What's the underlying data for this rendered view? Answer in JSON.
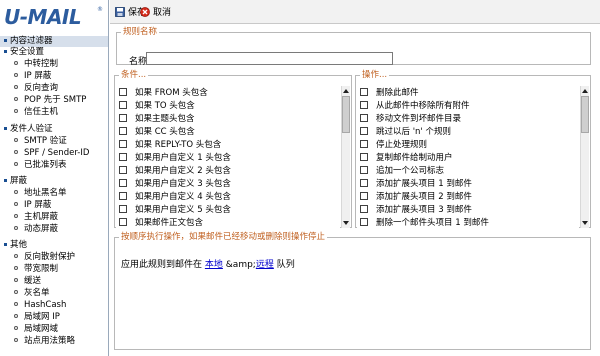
{
  "logo": {
    "text": "U-MAIL",
    "mark": "®"
  },
  "sidebar": {
    "items": [
      {
        "type": "head",
        "label": "内容过滤器",
        "selected": true
      },
      {
        "type": "head",
        "label": "安全设置"
      },
      {
        "type": "sub",
        "label": "中转控制"
      },
      {
        "type": "sub",
        "label": "IP 屏蔽"
      },
      {
        "type": "sub",
        "label": "反向查询"
      },
      {
        "type": "sub",
        "label": "POP 先于 SMTP"
      },
      {
        "type": "sub",
        "label": "信任主机"
      },
      {
        "type": "head",
        "label": "发件人验证"
      },
      {
        "type": "sub",
        "label": "SMTP 验证"
      },
      {
        "type": "sub",
        "label": "SPF / Sender-ID"
      },
      {
        "type": "sub",
        "label": "已批准列表"
      },
      {
        "type": "head",
        "label": "屏蔽"
      },
      {
        "type": "sub",
        "label": "地址黑名单"
      },
      {
        "type": "sub",
        "label": "IP 屏蔽"
      },
      {
        "type": "sub",
        "label": "主机屏蔽"
      },
      {
        "type": "sub",
        "label": "动态屏蔽"
      },
      {
        "type": "head",
        "label": "其他"
      },
      {
        "type": "sub",
        "label": "反向散射保护"
      },
      {
        "type": "sub",
        "label": "带宽限制"
      },
      {
        "type": "sub",
        "label": "缓送"
      },
      {
        "type": "sub",
        "label": "灰名单"
      },
      {
        "type": "sub",
        "label": "HashCash"
      },
      {
        "type": "sub",
        "label": "局域网 IP"
      },
      {
        "type": "sub",
        "label": "局域网域"
      },
      {
        "type": "sub",
        "label": "站点用法策略"
      }
    ]
  },
  "toolbar": {
    "save_label": "保存",
    "cancel_label": "取消"
  },
  "rule_name": {
    "legend": "规则名称",
    "label": "名称:",
    "value": ""
  },
  "conditions": {
    "legend": "条件...",
    "items": [
      "如果 FROM 头包含",
      "如果 TO 头包含",
      "如果主题头包含",
      "如果 CC 头包含",
      "如果 REPLY-TO 头包含",
      "如果用户自定义 1 头包含",
      "如果用户自定义 2 头包含",
      "如果用户自定义 3 头包含",
      "如果用户自定义 4 头包含",
      "如果用户自定义 5 头包含",
      "如果邮件正文包含"
    ]
  },
  "actions": {
    "legend": "操作...",
    "items": [
      "删除此邮件",
      "从此邮件中移除所有附件",
      "移动文件到坏邮件目录",
      "跳过以后 'n' 个规则",
      "停止处理规则",
      "复制邮件给制动用户",
      "追加一个公司标志",
      "添加扩展头项目 1 到邮件",
      "添加扩展头项目 2 到邮件",
      "添加扩展头项目 3 到邮件",
      "删除一个邮件头项目 1 到邮件"
    ]
  },
  "execution": {
    "legend": "按顺序执行操作，如果邮件已经移动或删除则操作停止",
    "prefix": "应用此规则到邮件在",
    "link1": "本地",
    "amp": "&amp;",
    "link2": "远程",
    "suffix": "队列"
  }
}
